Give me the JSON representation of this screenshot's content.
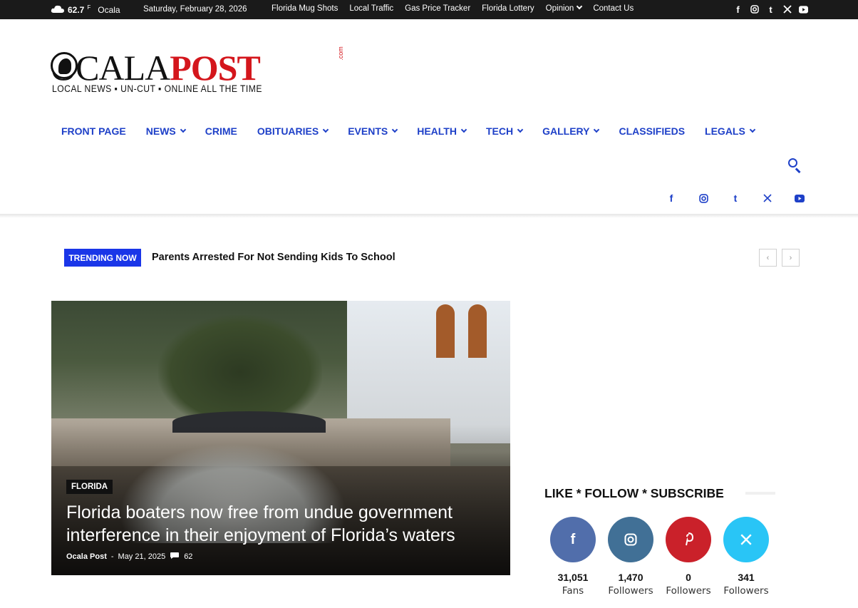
{
  "topbar": {
    "weather": {
      "temp": "62.7",
      "unit": "F",
      "city": "Ocala"
    },
    "date": "Saturday, February 28, 2026",
    "links": [
      "Florida Mug Shots",
      "Local Traffic",
      "Gas Price Tracker",
      "Florida Lottery",
      "Opinion",
      "Contact Us"
    ],
    "social_icons": [
      "facebook-icon",
      "instagram-icon",
      "tumblr-icon",
      "x-icon",
      "youtube-icon"
    ]
  },
  "logo": {
    "ocala": "OCALA",
    "post": "POST",
    "dotcom": ".com",
    "tagline": "LOCAL NEWS  ▪  UN-CUT  ▪  ONLINE ALL THE TIME",
    "colors": {
      "dark": "#111111",
      "red": "#d4161c"
    }
  },
  "nav": {
    "items": [
      {
        "label": "FRONT PAGE",
        "dropdown": false
      },
      {
        "label": "NEWS",
        "dropdown": true
      },
      {
        "label": "CRIME",
        "dropdown": false
      },
      {
        "label": "OBITUARIES",
        "dropdown": true
      },
      {
        "label": "EVENTS",
        "dropdown": true
      },
      {
        "label": "HEALTH",
        "dropdown": true
      },
      {
        "label": "TECH",
        "dropdown": true
      },
      {
        "label": "GALLERY",
        "dropdown": true
      },
      {
        "label": "CLASSIFIEDS",
        "dropdown": false
      },
      {
        "label": "LEGALS",
        "dropdown": true
      }
    ],
    "accent": "#1e40c8"
  },
  "trending": {
    "label": "TRENDING NOW",
    "headline": "Parents Arrested For Not Sending Kids To School",
    "prev": "‹",
    "next": "›"
  },
  "hero": {
    "category": "FLORIDA",
    "title": "Florida boaters now free from undue government interference in their enjoyment of Florida’s waters",
    "author": "Ocala Post",
    "separator": "-",
    "date": "May 21, 2025",
    "comments": "62"
  },
  "sidebar": {
    "title": "LIKE * FOLLOW * SUBSCRIBE",
    "socials": [
      {
        "icon": "facebook-icon",
        "glyph": "f",
        "color": "#516eab",
        "count": "31,051",
        "label": "Fans"
      },
      {
        "icon": "instagram-icon",
        "glyph": "◎",
        "color": "#417096",
        "count": "1,470",
        "label": "Followers"
      },
      {
        "icon": "pinterest-icon",
        "glyph": "P",
        "color": "#ca212a",
        "count": "0",
        "label": "Followers"
      },
      {
        "icon": "x-icon",
        "glyph": "𝕏",
        "color": "#29c5f6",
        "count": "341",
        "label": "Followers"
      }
    ]
  }
}
